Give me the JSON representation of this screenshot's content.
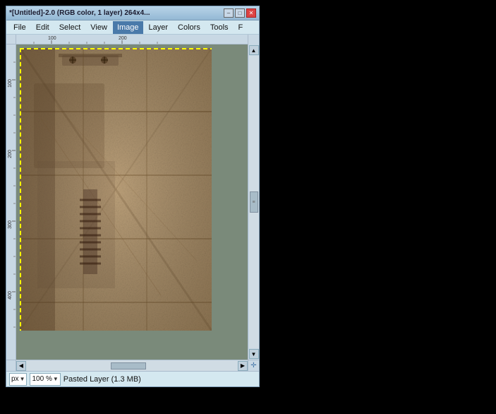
{
  "window": {
    "title": "*[Untitled]-2.0 (RGB color, 1 layer) 264x4...",
    "controls": {
      "minimize": "–",
      "maximize": "□",
      "close": "✕"
    }
  },
  "menu": {
    "items": [
      {
        "id": "file",
        "label": "File"
      },
      {
        "id": "edit",
        "label": "Edit"
      },
      {
        "id": "select",
        "label": "Select"
      },
      {
        "id": "view",
        "label": "View"
      },
      {
        "id": "image",
        "label": "Image"
      },
      {
        "id": "layer",
        "label": "Layer"
      },
      {
        "id": "colors",
        "label": "Colors"
      },
      {
        "id": "tools",
        "label": "Tools"
      },
      {
        "id": "f",
        "label": "F"
      }
    ]
  },
  "ruler": {
    "h_labels": [
      "100",
      "200"
    ],
    "v_labels": [
      "100",
      "200",
      "300",
      "400"
    ]
  },
  "status_bar": {
    "zoom_value": "100 %",
    "unit": "px",
    "layer_info": "Pasted Layer (1.3 MB)"
  },
  "scroll": {
    "up_arrow": "▲",
    "down_arrow": "▼",
    "left_arrow": "◀",
    "right_arrow": "▶",
    "resize_icon": "✛"
  }
}
